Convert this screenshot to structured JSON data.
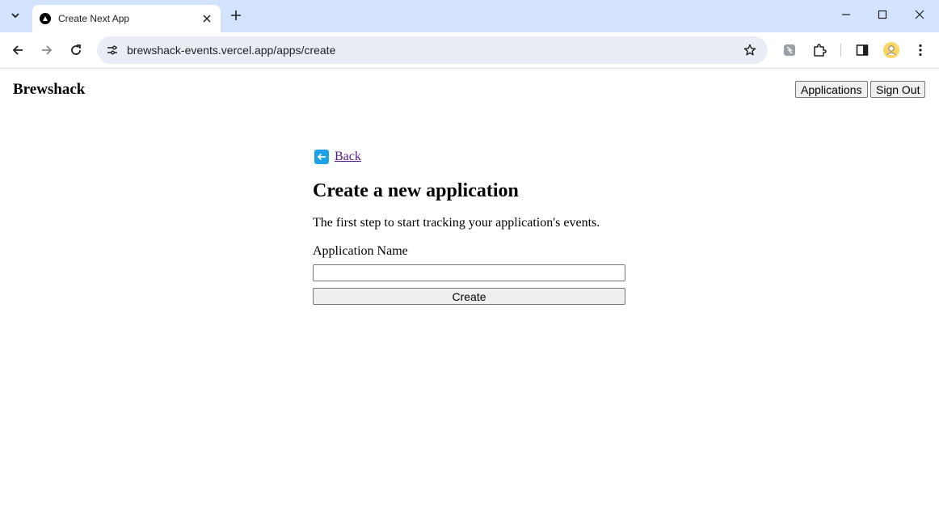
{
  "browser": {
    "tab": {
      "title": "Create Next App",
      "favicon": "triangle-logo-icon"
    },
    "url": "brewshack-events.vercel.app/apps/create",
    "icons": {
      "tab_search": "chevron-down-icon",
      "tab_close": "close-icon",
      "new_tab": "plus-icon",
      "minimize": "minimize-icon",
      "maximize": "maximize-icon",
      "close_window": "close-icon",
      "back": "arrow-left-icon",
      "forward": "arrow-right-icon",
      "reload": "reload-icon",
      "site_info": "tune-icon",
      "bookmark": "star-icon",
      "extension_1": "extension-badge-icon",
      "extensions": "puzzle-icon",
      "side_panel": "side-panel-icon",
      "profile": "avatar-icon",
      "menu": "kebab-menu-icon"
    },
    "colors": {
      "tabbar": "#d3e3fd",
      "omnibox": "#e9eef6"
    }
  },
  "header": {
    "brand": "Brewshack",
    "applications_label": "Applications",
    "signout_label": "Sign Out"
  },
  "main": {
    "back_label": "Back",
    "back_icon": "arrow-left-box-icon",
    "title": "Create a new application",
    "description": "The first step to start tracking your application's events.",
    "field_label": "Application Name",
    "field_value": "",
    "create_label": "Create",
    "colors": {
      "link": "#551a8b",
      "back_icon": "#1da1e8"
    }
  }
}
